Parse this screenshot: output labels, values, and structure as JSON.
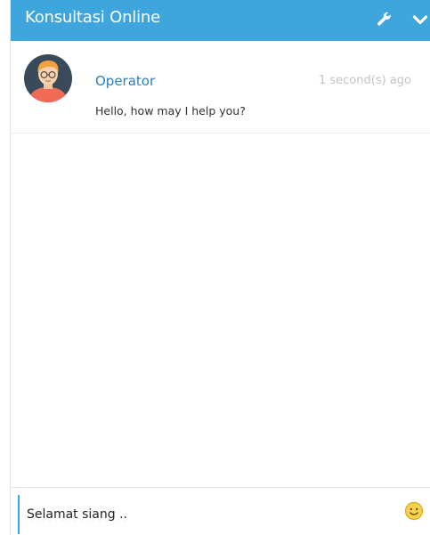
{
  "header": {
    "title": "Konsultasi Online",
    "settings_icon": "wrench-icon",
    "minimize_icon": "chevron-down-icon"
  },
  "message": {
    "sender": "Operator",
    "timestamp": "1 second(s) ago",
    "text": "Hello, how may I help you?",
    "avatar_icon": "operator-avatar"
  },
  "composer": {
    "value": "Selamat siang ..",
    "emoji_icon": "smiley-icon"
  },
  "colors": {
    "header_bg": "#3ea6dc",
    "sender_name": "#2d80b8",
    "timestamp": "#c4c4c4"
  }
}
